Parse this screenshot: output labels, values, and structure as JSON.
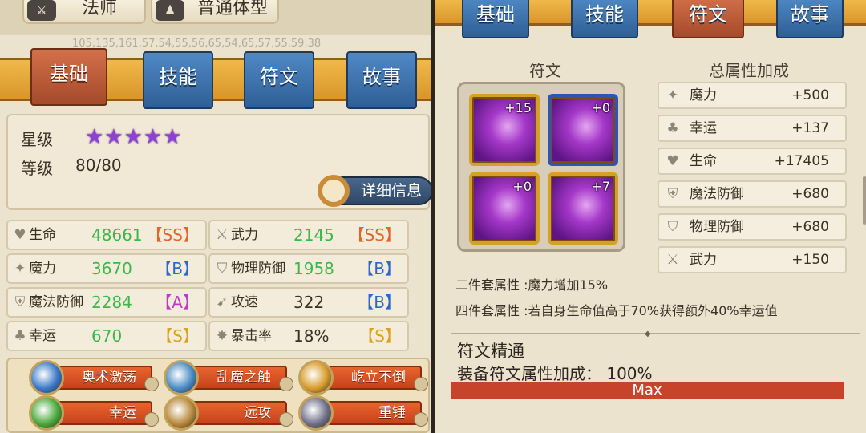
{
  "left": {
    "header": {
      "class_button": {
        "icon": "class-icon",
        "label": "法师"
      },
      "body_button": {
        "icon": "body-type-icon",
        "label": "普通体型"
      },
      "faded_numbers": "105,135,161,57,54,55,56,65,54,65,57,55,59,38"
    },
    "tabs": [
      "基础",
      "技能",
      "符文",
      "故事"
    ],
    "active_tab": "基础",
    "info": {
      "star_label": "星级",
      "stars": "★★★★★",
      "star_count": 5,
      "level_label": "等级",
      "level_value": "80/80",
      "detail_button": "详细信息"
    },
    "stats": [
      {
        "icon": "health-icon",
        "name": "生命",
        "value": "48661",
        "grade": "【SS】",
        "grade_color": "#e0662a"
      },
      {
        "icon": "sword-icon",
        "name": "武力",
        "value": "2145",
        "grade": "【SS】",
        "grade_color": "#e0662a"
      },
      {
        "icon": "magic-icon",
        "name": "魔力",
        "value": "3670",
        "grade": "【B】",
        "grade_color": "#2c66d0"
      },
      {
        "icon": "shield-icon",
        "name": "物理防御",
        "value": "1958",
        "grade": "【B】",
        "grade_color": "#2c66d0"
      },
      {
        "icon": "magic-shield-icon",
        "name": "魔法防御",
        "value": "2284",
        "grade": "【A】",
        "grade_color": "#c03ac6"
      },
      {
        "icon": "attack-speed-icon",
        "name": "攻速",
        "value": "322",
        "grade": "【B】",
        "grade_color": "#2c66d0"
      },
      {
        "icon": "clover-icon",
        "name": "幸运",
        "value": "670",
        "grade": "【S】",
        "grade_color": "#d9a21f"
      },
      {
        "icon": "crit-icon",
        "name": "暴击率",
        "value": "18%",
        "grade": "【S】",
        "grade_color": "#d9a21f"
      }
    ],
    "skills": [
      {
        "icon": "arcane-orb-icon",
        "label": "奥术激荡",
        "icon_color": "#3a78c8"
      },
      {
        "icon": "chaos-touch-icon",
        "label": "乱魔之触",
        "icon_color": "#4a8ac4"
      },
      {
        "icon": "steadfast-icon",
        "label": "屹立不倒",
        "icon_color": "#d89b2a"
      },
      {
        "icon": "four-leaf-clover-icon",
        "label": "幸运",
        "icon_color": "#49a83a"
      },
      {
        "icon": "bow-icon",
        "label": "远攻",
        "icon_color": "#b8883a"
      },
      {
        "icon": "hammer-icon",
        "label": "重锤",
        "icon_color": "#6e6e88"
      }
    ]
  },
  "right": {
    "tabs": [
      "基础",
      "技能",
      "符文",
      "故事"
    ],
    "active_tab": "符文",
    "rune_title": "符文",
    "bonus_title": "总属性加成",
    "runes": [
      {
        "level": "+15",
        "frame": "gold"
      },
      {
        "level": "+0",
        "frame": "blue"
      },
      {
        "level": "+0",
        "frame": "gold"
      },
      {
        "level": "+7",
        "frame": "gold"
      }
    ],
    "bonuses": [
      {
        "icon": "magic-icon",
        "name": "魔力",
        "value": "+500"
      },
      {
        "icon": "clover-icon",
        "name": "幸运",
        "value": "+137"
      },
      {
        "icon": "health-icon",
        "name": "生命",
        "value": "+17405"
      },
      {
        "icon": "magic-shield-icon",
        "name": "魔法防御",
        "value": "+680"
      },
      {
        "icon": "shield-icon",
        "name": "物理防御",
        "value": "+680"
      },
      {
        "icon": "sword-icon",
        "name": "武力",
        "value": "+150"
      }
    ],
    "set_two": "二件套属性 :魔力增加15%",
    "set_four": "四件套属性 :若自身生命值高于70%获得额外40%幸运值",
    "mastery_title": "符文精通",
    "mastery_line": "装备符文属性加成： 100%",
    "max_label": "Max"
  }
}
